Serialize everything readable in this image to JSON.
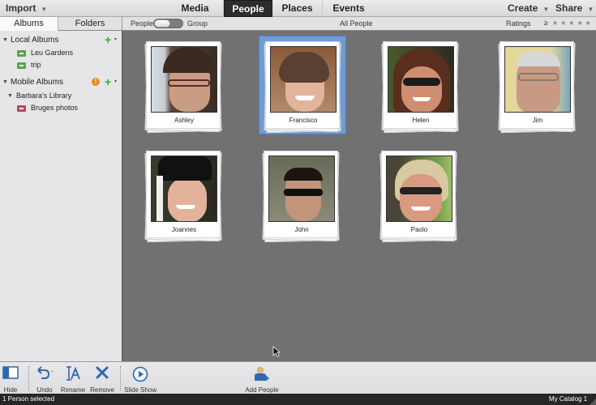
{
  "topbar": {
    "import_label": "Import",
    "tabs": [
      {
        "label": "Media",
        "active": false
      },
      {
        "label": "People",
        "active": true
      },
      {
        "label": "Places",
        "active": false
      },
      {
        "label": "Events",
        "active": false
      }
    ],
    "create_label": "Create",
    "share_label": "Share"
  },
  "subbar": {
    "albums_tab": "Albums",
    "folders_tab": "Folders",
    "toggle_left": "People",
    "toggle_right": "Group",
    "view_title": "All People",
    "ratings_label": "Ratings",
    "ratings_operator": "≥",
    "ratings_stars": "★★★★★",
    "ratings_value": 0
  },
  "sidebar": {
    "local_albums": {
      "label": "Local Albums",
      "items": [
        {
          "label": "Leu Gardens",
          "icon": "album-icon"
        },
        {
          "label": "trip",
          "icon": "album-icon"
        }
      ]
    },
    "mobile_albums": {
      "label": "Mobile Albums",
      "alert": "!",
      "library": {
        "label": "Barbara's Library",
        "items": [
          {
            "label": "Bruges photos",
            "icon": "mobile-album-icon"
          }
        ]
      }
    },
    "add_symbol": "+",
    "caret_symbol": "▾"
  },
  "people": [
    {
      "name": "Ashley",
      "selected": false
    },
    {
      "name": "Francisco",
      "selected": true
    },
    {
      "name": "Helen",
      "selected": false
    },
    {
      "name": "Jim",
      "selected": false
    },
    {
      "name": "Joannes",
      "selected": false
    },
    {
      "name": "John",
      "selected": false
    },
    {
      "name": "Paolo",
      "selected": false
    }
  ],
  "toolbar": {
    "hide_label": "Hide",
    "undo_label": "Undo",
    "rename_label": "Rename",
    "remove_label": "Remove",
    "slideshow_label": "Slide Show",
    "add_people_label": "Add People"
  },
  "status": {
    "selection_text": "1 Person selected",
    "catalog_name": "My Catalog 1"
  }
}
